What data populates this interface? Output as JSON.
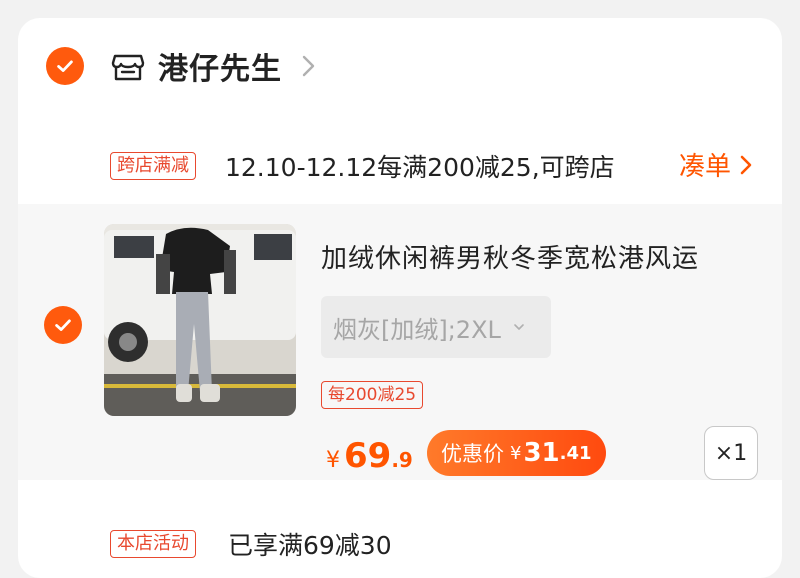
{
  "store": {
    "name": "港仔先生",
    "selected": true
  },
  "promo": {
    "tag": "跨店满减",
    "text": "12.10-12.12每满200减25,可跨店",
    "action": "凑单"
  },
  "item": {
    "selected": true,
    "title": "加绒休闲裤男秋冬季宽松港风运",
    "sku": "烟灰[加绒];2XL",
    "tag": "每200减25",
    "price_symbol": "¥",
    "price_int": "69",
    "price_dec": ".9",
    "discount_label": "优惠价",
    "discount_symbol": "¥",
    "discount_int": "31",
    "discount_dec": ".41",
    "quantity": "×1"
  },
  "store_activity": {
    "tag": "本店活动",
    "text": "已享满69减30"
  },
  "colors": {
    "accent": "#ff5500",
    "tag_red": "#e8492f",
    "check": "#ff5a0d"
  }
}
